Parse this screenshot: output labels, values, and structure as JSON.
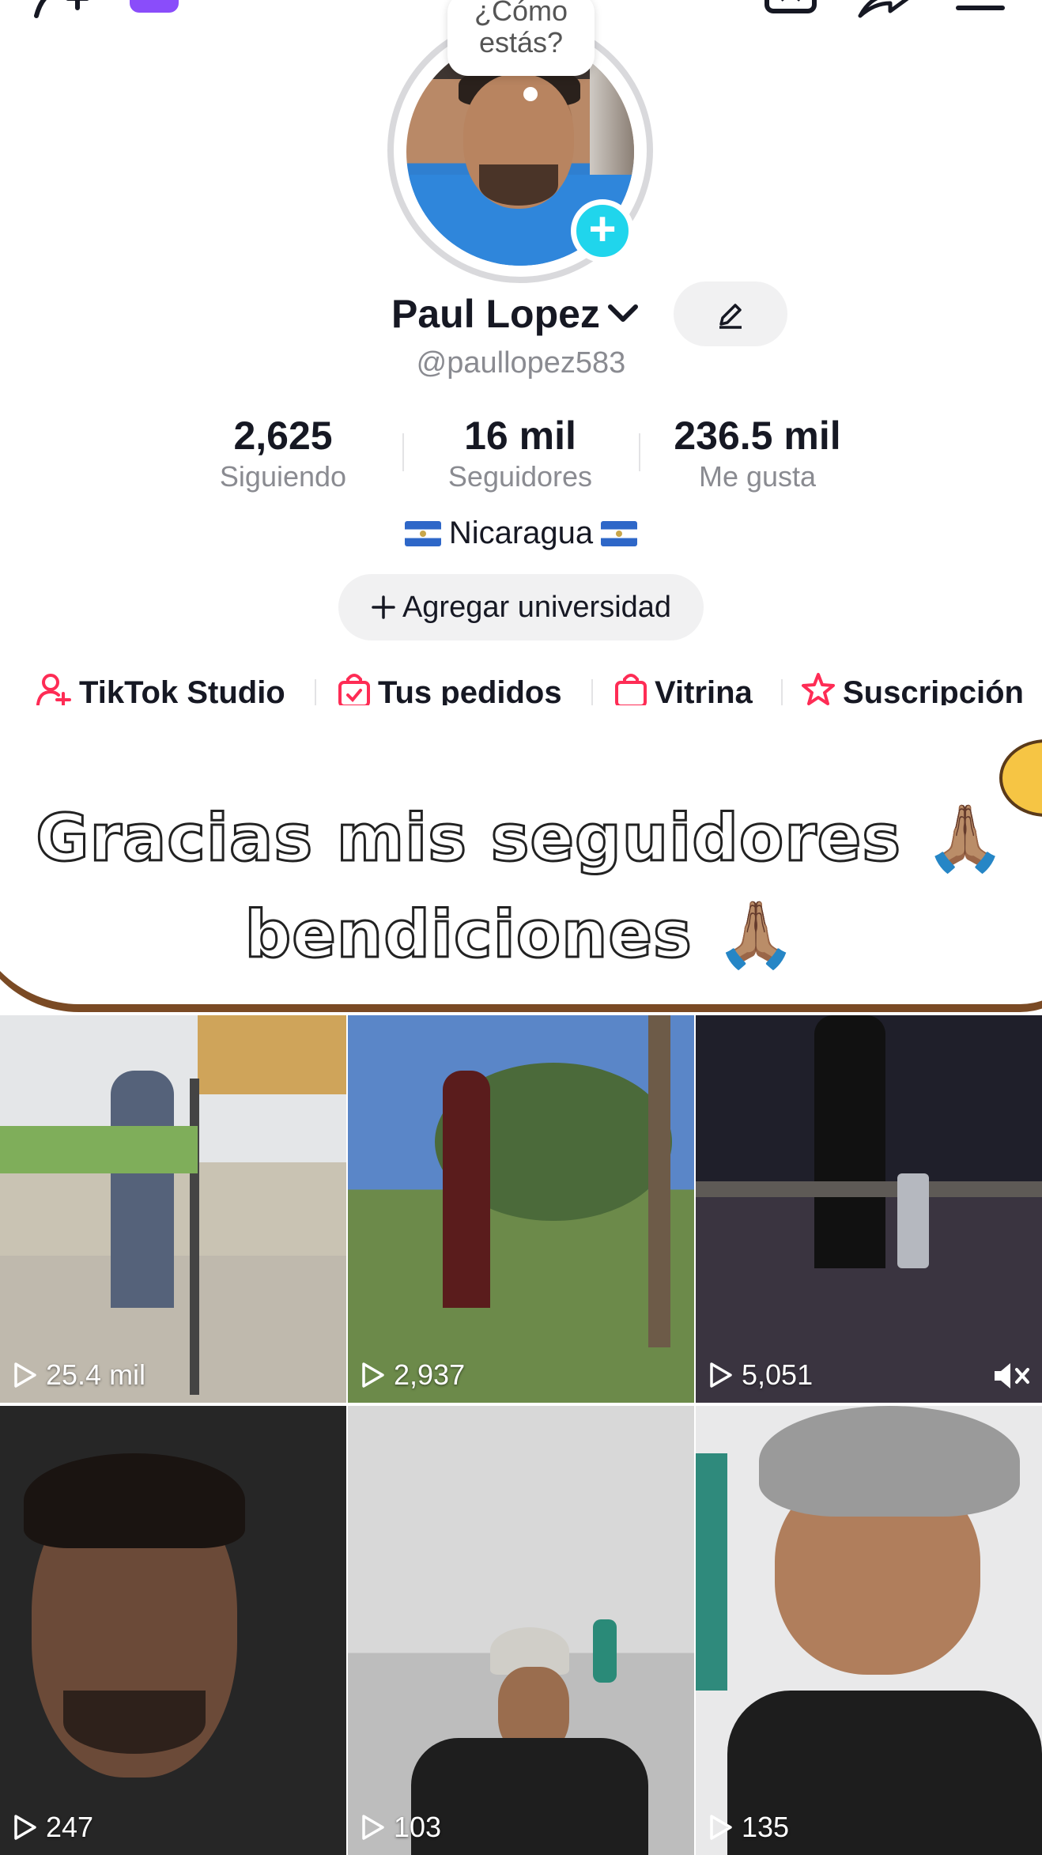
{
  "status_bubble": {
    "text_line1": "¿Cómo",
    "text_line2": "estás?"
  },
  "profile": {
    "name": "Paul Lopez",
    "handle": "@paullopez583",
    "location": "Nicaragua"
  },
  "stats": [
    {
      "value": "2,625",
      "label": "Siguiendo"
    },
    {
      "value": "16 mil",
      "label": "Seguidores"
    },
    {
      "value": "236.5 mil",
      "label": "Me gusta"
    }
  ],
  "university_button": {
    "label": "Agregar universidad",
    "icon": "plus-icon"
  },
  "quick_links": [
    {
      "label": "TikTok Studio",
      "icon": "creator-icon",
      "color": "#fe2c55"
    },
    {
      "label": "Tus pedidos",
      "icon": "shopping-bag-check-icon",
      "color": "#fe2c55"
    },
    {
      "label": "Vitrina",
      "icon": "shopping-bag-icon",
      "color": "#fe2c55"
    },
    {
      "label": "Suscripción",
      "icon": "star-icon",
      "color": "#fe2c55"
    }
  ],
  "banner": {
    "line1": "Gracias mis seguidores 🙏🏽",
    "line2": "bendiciones 🙏🏽"
  },
  "videos": [
    {
      "views": "25.4 mil"
    },
    {
      "views": "2,937"
    },
    {
      "views": "5,051",
      "muted": true
    },
    {
      "views": "247"
    },
    {
      "views": "103"
    },
    {
      "views": "135"
    }
  ],
  "colors": {
    "accent_cyan": "#20d5ec",
    "accent_red": "#fe2c55",
    "muted_text": "#8a8b91"
  }
}
